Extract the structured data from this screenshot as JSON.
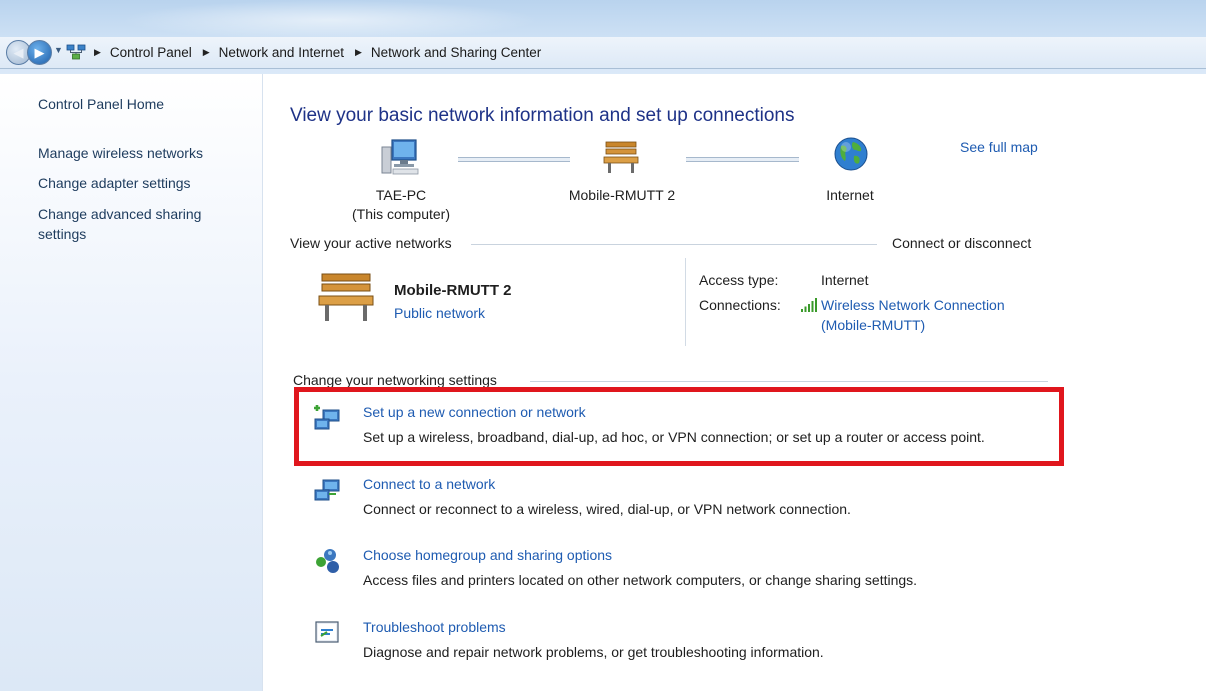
{
  "navigation": {
    "back_icon": "back-arrow-icon",
    "forward_icon": "forward-arrow-icon",
    "breadcrumb": [
      "Control Panel",
      "Network and Internet",
      "Network and Sharing Center"
    ]
  },
  "sidebar": {
    "items": [
      {
        "label": "Control Panel Home"
      },
      {
        "label": "Manage wireless networks"
      },
      {
        "label": "Change adapter settings"
      },
      {
        "label": "Change advanced sharing"
      },
      {
        "label": "settings"
      }
    ]
  },
  "main": {
    "title": "View your basic network information and set up connections",
    "see_full_map": "See full map",
    "map": {
      "computer_name": "TAE-PC",
      "computer_note": "(This computer)",
      "network_name": "Mobile-RMUTT  2",
      "internet_label": "Internet"
    },
    "active": {
      "header": "View your active networks",
      "connect_link": "Connect or disconnect",
      "network_name": "Mobile-RMUTT  2",
      "network_type": "Public network",
      "access_type_label": "Access type:",
      "access_type_value": "Internet",
      "connections_label": "Connections:",
      "connection_line1": "Wireless Network Connection",
      "connection_line2": "(Mobile-RMUTT)"
    },
    "settings": {
      "header": "Change your networking settings",
      "tasks": [
        {
          "title": "Set up a new connection or network",
          "desc": "Set up a wireless, broadband, dial-up, ad hoc, or VPN connection; or set up a router or access point."
        },
        {
          "title": "Connect to a network",
          "desc": "Connect or reconnect to a wireless, wired, dial-up, or VPN network connection."
        },
        {
          "title": "Choose homegroup and sharing options",
          "desc": "Access files and printers located on other network computers, or change sharing settings."
        },
        {
          "title": "Troubleshoot problems",
          "desc": "Diagnose and repair network problems, or get troubleshooting information."
        }
      ]
    }
  },
  "colors": {
    "link": "#1e5bb1",
    "title": "#1e3287",
    "highlight": "#e0161d"
  }
}
